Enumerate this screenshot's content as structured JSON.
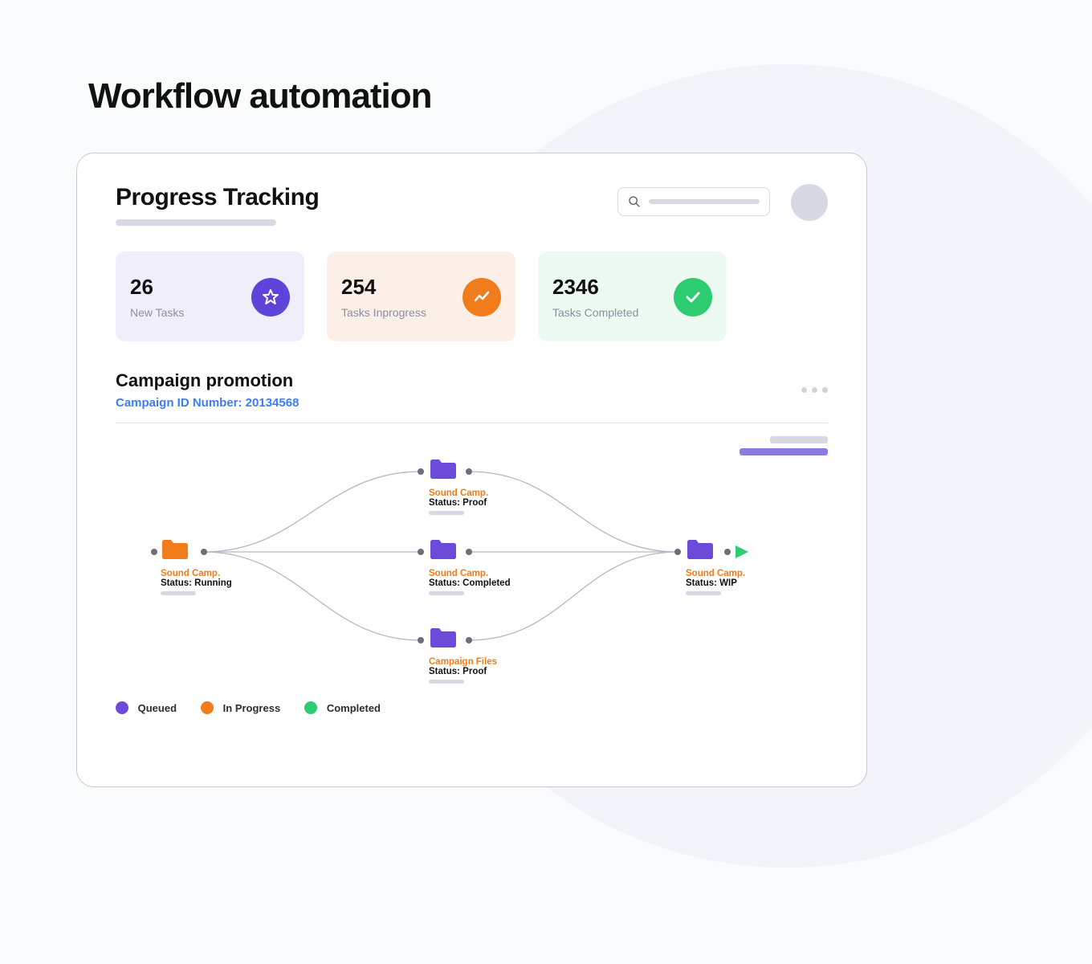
{
  "page_title": "Workflow automation",
  "panel": {
    "title": "Progress Tracking",
    "search_placeholder": "",
    "cards": [
      {
        "count": "26",
        "label": "New Tasks",
        "color": "purple"
      },
      {
        "count": "254",
        "label": "Tasks Inprogress",
        "color": "orange"
      },
      {
        "count": "2346",
        "label": "Tasks Completed",
        "color": "green"
      }
    ]
  },
  "campaign": {
    "title": "Campaign promotion",
    "id_label": "Campaign ID Number: 20134568"
  },
  "nodes": {
    "start": {
      "title": "Sound Camp.",
      "status": "Status: Running",
      "color": "#F07C1B"
    },
    "top": {
      "title": "Sound Camp.",
      "status": "Status: Proof",
      "color": "#6C4BD9"
    },
    "mid": {
      "title": "Sound Camp.",
      "status": "Status: Completed",
      "color": "#6C4BD9"
    },
    "bottom": {
      "title": "Campaign Files",
      "status": "Status: Proof",
      "color": "#6C4BD9"
    },
    "end": {
      "title": "Sound Camp.",
      "status": "Status: WIP",
      "color": "#6C4BD9"
    }
  },
  "legend": {
    "queued": {
      "label": "Queued",
      "color": "#6C4BD9"
    },
    "in_progress": {
      "label": "In Progress",
      "color": "#F07C1B"
    },
    "completed": {
      "label": "Completed",
      "color": "#2ECC71"
    }
  }
}
